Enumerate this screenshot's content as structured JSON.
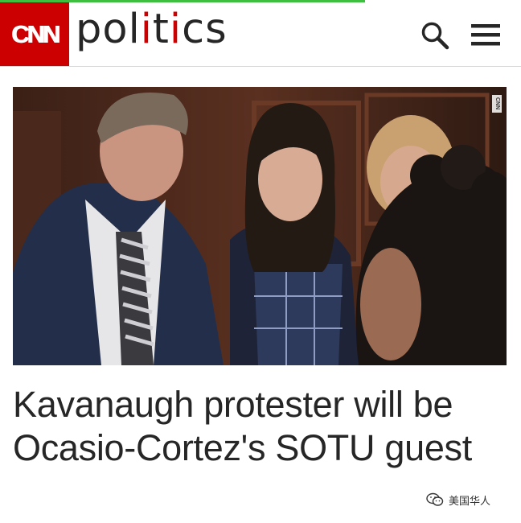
{
  "page_progress": 0.7,
  "header": {
    "logo_text": "CNN",
    "section_parts": [
      "pol",
      "i",
      "t",
      "i",
      "cs"
    ],
    "search_icon": "search-icon",
    "menu_icon": "hamburger-menu-icon"
  },
  "hero": {
    "network_bug": "CNN"
  },
  "article": {
    "headline": "Kavanaugh protester will be Ocasio-Cortez's SOTU guest"
  },
  "watermark": {
    "text": "美国华人",
    "icon": "wechat-icon"
  },
  "colors": {
    "brand_red": "#cc0000",
    "progress_green": "#3fbf3f",
    "text_dark": "#262626"
  }
}
